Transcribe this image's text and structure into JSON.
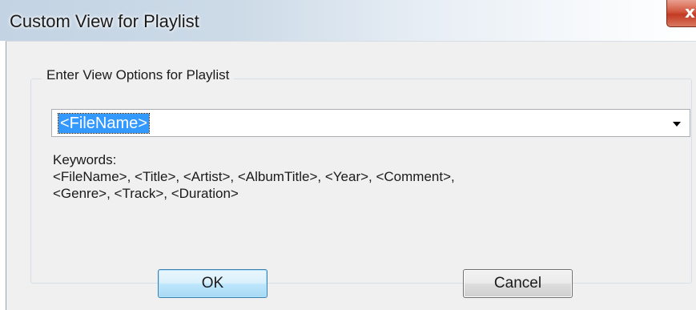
{
  "window": {
    "title": "Custom View for Playlist",
    "close_glyph": "x"
  },
  "group": {
    "label": "Enter View Options for Playlist"
  },
  "combo": {
    "value": "<FileName>",
    "arrow_icon": "chevron-down-icon"
  },
  "keywords": {
    "heading": "Keywords:",
    "line1": "<FileName>, <Title>, <Artist>, <AlbumTitle>, <Year>, <Comment>,",
    "line2": "<Genre>, <Track>, <Duration>"
  },
  "buttons": {
    "ok_label": "OK",
    "cancel_label": "Cancel"
  },
  "colors": {
    "selection": "#3399ff",
    "close_button": "#c8432b",
    "client_bg": "#f0f0f0",
    "default_button_border": "#3c7fb1"
  }
}
